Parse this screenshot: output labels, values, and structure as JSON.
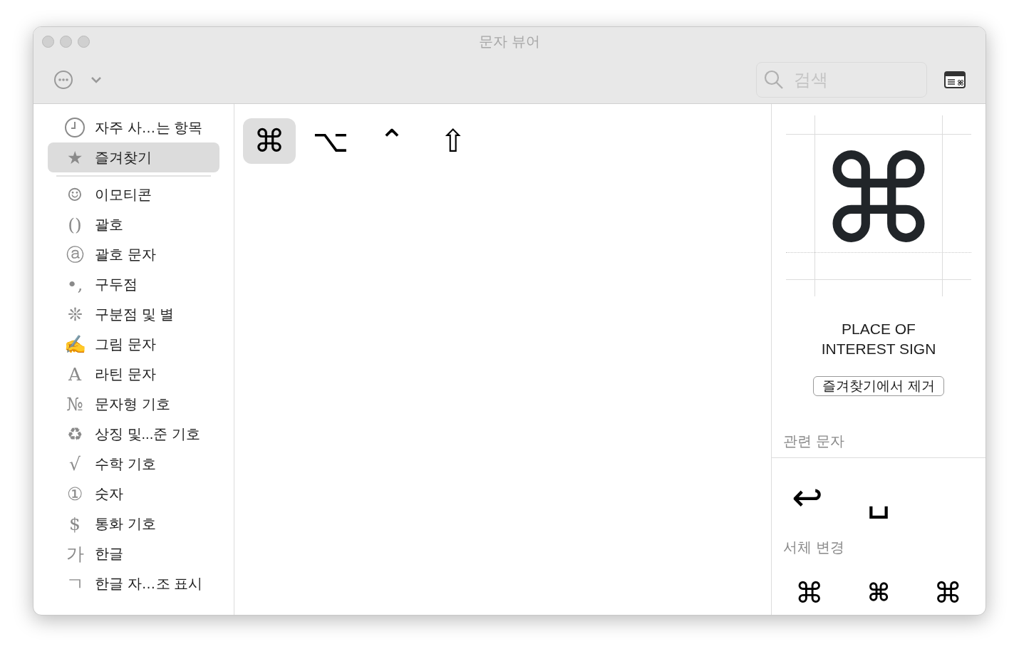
{
  "window": {
    "title": "문자 뷰어"
  },
  "toolbar": {
    "search": {
      "placeholder": "검색"
    }
  },
  "sidebar": {
    "items": [
      {
        "kind": "clock",
        "label": "자주 사…는 항목",
        "selected": false
      },
      {
        "kind": "glyph",
        "icon": "★",
        "label": "즐겨찾기",
        "selected": true
      },
      {
        "kind": "divider"
      },
      {
        "kind": "glyph",
        "icon": "☺",
        "label": "이모티콘",
        "selected": false
      },
      {
        "kind": "glyph",
        "icon": "()",
        "label": "괄호",
        "selected": false
      },
      {
        "kind": "glyph",
        "icon": "ⓐ",
        "label": "괄호 문자",
        "selected": false
      },
      {
        "kind": "glyph",
        "icon": "•,",
        "label": "구두점",
        "selected": false
      },
      {
        "kind": "glyph",
        "icon": "❊",
        "label": "구분점 및 별",
        "selected": false
      },
      {
        "kind": "glyph",
        "icon": "✍",
        "label": "그림 문자",
        "selected": false
      },
      {
        "kind": "glyph",
        "icon": "A",
        "label": "라틴 문자",
        "selected": false
      },
      {
        "kind": "glyph",
        "icon": "№",
        "label": "문자형 기호",
        "selected": false
      },
      {
        "kind": "glyph",
        "icon": "♻",
        "label": "상징 및...준 기호",
        "selected": false
      },
      {
        "kind": "glyph",
        "icon": "√",
        "label": "수학 기호",
        "selected": false
      },
      {
        "kind": "glyph",
        "icon": "①",
        "label": "숫자",
        "selected": false
      },
      {
        "kind": "glyph",
        "icon": "$",
        "label": "통화 기호",
        "selected": false
      },
      {
        "kind": "glyph",
        "icon": "가",
        "label": "한글",
        "selected": false
      },
      {
        "kind": "glyph",
        "icon": "ㄱ",
        "label": "한글 자…조 표시",
        "selected": false
      }
    ]
  },
  "characters": [
    {
      "char": "⌘",
      "selected": true
    },
    {
      "char": "⌥",
      "selected": false
    },
    {
      "char": "⌃",
      "selected": false
    },
    {
      "char": "⇧",
      "selected": false
    }
  ],
  "detail": {
    "preview": "⌘",
    "name": "PLACE OF INTEREST SIGN",
    "button": "즐겨찾기에서 제거",
    "related_heading": "관련 문자",
    "related": [
      "↩",
      "␣"
    ],
    "variants_heading": "서체 변경",
    "variants": [
      "⌘",
      "⌘",
      "⌘"
    ]
  }
}
